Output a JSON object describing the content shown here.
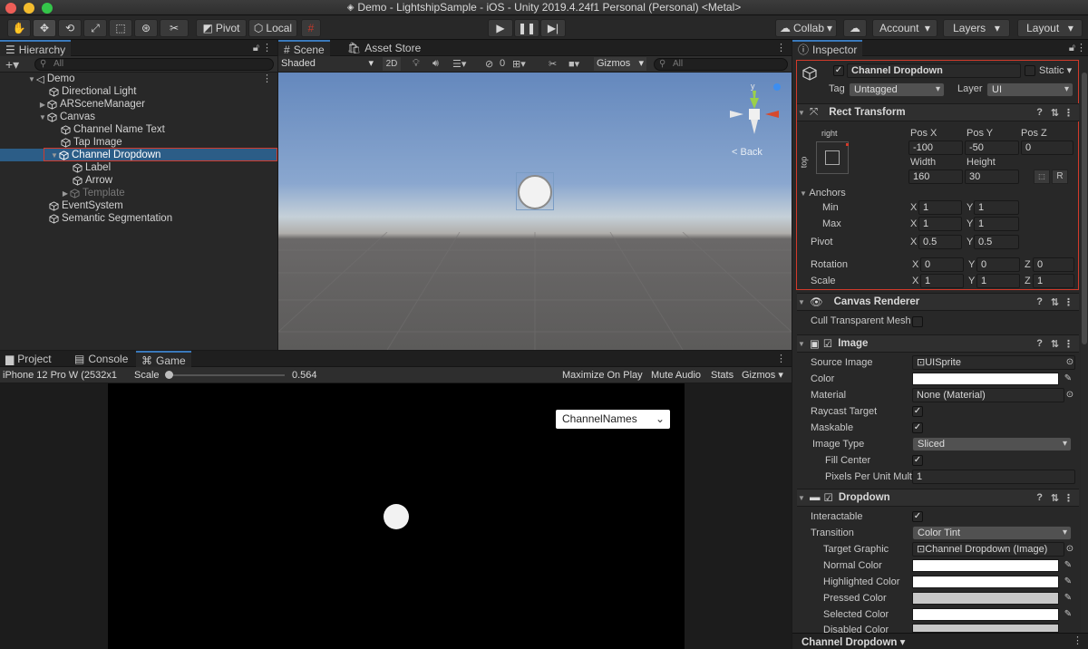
{
  "window": {
    "title": "Demo - LightshipSample - iOS - Unity 2019.4.24f1 Personal (Personal) <Metal>"
  },
  "toolbar": {
    "pivot_label": "Pivot",
    "local_label": "Local",
    "collab_label": "Collab",
    "account_label": "Account",
    "layers_label": "Layers",
    "layout_label": "Layout"
  },
  "hierarchy": {
    "tab": "Hierarchy",
    "search_placeholder": "All",
    "items": [
      {
        "label": "Demo"
      },
      {
        "label": "Directional Light"
      },
      {
        "label": "ARSceneManager"
      },
      {
        "label": "Canvas"
      },
      {
        "label": "Channel Name Text"
      },
      {
        "label": "Tap Image"
      },
      {
        "label": "Channel Dropdown"
      },
      {
        "label": "Label"
      },
      {
        "label": "Arrow"
      },
      {
        "label": "Template"
      },
      {
        "label": "EventSystem"
      },
      {
        "label": "Semantic Segmentation"
      }
    ]
  },
  "scene": {
    "tabs": [
      "Scene",
      "Asset Store"
    ],
    "shading": "Shaded",
    "mode_2d": "2D",
    "hidden_count": "0",
    "gizmos": "Gizmos",
    "search_placeholder": "All",
    "axis_y": "y",
    "back_label": "< Back"
  },
  "game": {
    "tabs": [
      "Project",
      "Console",
      "Game"
    ],
    "device": "iPhone 12 Pro W (2532x1",
    "scale_label": "Scale",
    "scale_value": "0.564",
    "maximize": "Maximize On Play",
    "mute": "Mute Audio",
    "stats": "Stats",
    "gizmos": "Gizmos",
    "dropdown_text": "ChannelNames"
  },
  "inspector": {
    "tab": "Inspector",
    "object_name": "Channel Dropdown",
    "static_label": "Static",
    "tag_label": "Tag",
    "tag_value": "Untagged",
    "layer_label": "Layer",
    "layer_value": "UI",
    "rect": {
      "title": "Rect Transform",
      "anchor_h": "right",
      "anchor_v": "top",
      "posx_label": "Pos X",
      "posx": "-100",
      "posy_label": "Pos Y",
      "posy": "-50",
      "posz_label": "Pos Z",
      "posz": "0",
      "width_label": "Width",
      "width": "160",
      "height_label": "Height",
      "height": "30",
      "r_label": "R",
      "anchors_label": "Anchors",
      "min_label": "Min",
      "min_x": "1",
      "min_y": "1",
      "max_label": "Max",
      "max_x": "1",
      "max_y": "1",
      "pivot_label": "Pivot",
      "pivot_x": "0.5",
      "pivot_y": "0.5",
      "rotation_label": "Rotation",
      "rot_x": "0",
      "rot_y": "0",
      "rot_z": "0",
      "scale_label": "Scale",
      "scale_x": "1",
      "scale_y": "1",
      "scale_z": "1",
      "x": "X",
      "y": "Y",
      "z": "Z"
    },
    "canvas_renderer": {
      "title": "Canvas Renderer",
      "cull_label": "Cull Transparent Mesh"
    },
    "image": {
      "title": "Image",
      "source_label": "Source Image",
      "source_value": "UISprite",
      "color_label": "Color",
      "material_label": "Material",
      "material_value": "None (Material)",
      "raycast_label": "Raycast Target",
      "maskable_label": "Maskable",
      "type_label": "Image Type",
      "type_value": "Sliced",
      "fill_center_label": "Fill Center",
      "ppu_label": "Pixels Per Unit Mult",
      "ppu_value": "1"
    },
    "dropdown": {
      "title": "Dropdown",
      "interactable_label": "Interactable",
      "transition_label": "Transition",
      "transition_value": "Color Tint",
      "target_label": "Target Graphic",
      "target_value": "Channel Dropdown (Image)",
      "normal_label": "Normal Color",
      "highlighted_label": "Highlighted Color",
      "pressed_label": "Pressed Color",
      "selected_label": "Selected Color",
      "disabled_label": "Disabled Color"
    },
    "footer": "Channel Dropdown"
  },
  "colors": {
    "selection": "#2c5d87",
    "highlight_box": "#d23a2a",
    "swatch_white": "#ffffff",
    "swatch_pressed": "#c8c8c8",
    "swatch_disabled": "#c8c8c8"
  }
}
